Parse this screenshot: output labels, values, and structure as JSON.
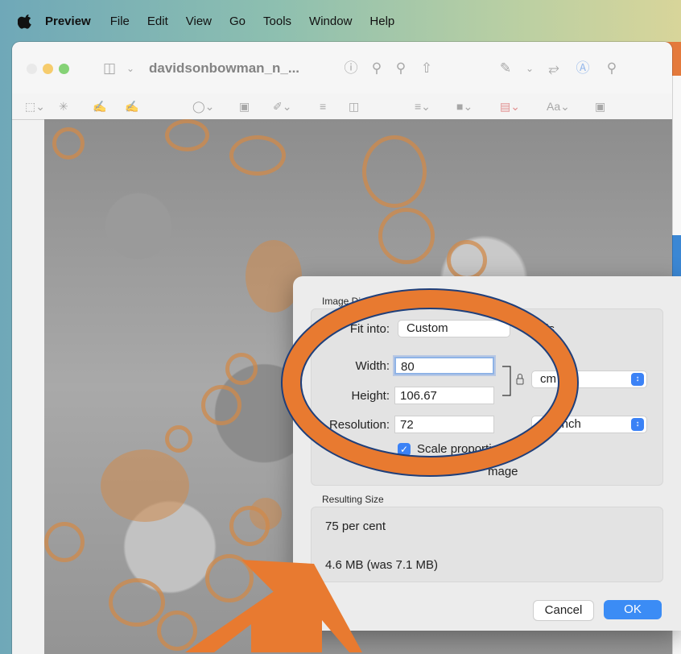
{
  "menubar": {
    "app_name": "Preview",
    "items": [
      "File",
      "Edit",
      "View",
      "Go",
      "Tools",
      "Window",
      "Help"
    ]
  },
  "window": {
    "document_title": "davidsonbowman_n_..."
  },
  "dialog": {
    "image_dimensions_label": "Image Dimensions",
    "fit_into_label": "Fit into:",
    "fit_into_value": "Custom",
    "fit_into_unit_partial": "ixels",
    "width_label": "Width:",
    "width_value": "80",
    "height_label": "Height:",
    "height_value": "106.67",
    "resolution_label": "Resolution:",
    "resolution_value": "72",
    "size_unit_partial": "cm",
    "resolution_unit_partial": "els/inch",
    "scale_label_partial": "Scale proporti",
    "resample_partial": "mage",
    "resulting_size_label": "Resulting Size",
    "percent_text": "75 per cent",
    "size_text": "4.6 MB (was 7.1 MB)",
    "cancel_label": "Cancel",
    "ok_label": "OK"
  },
  "colors": {
    "annotation_orange": "#e87a30",
    "annotation_outline": "#1f3f7a",
    "accent_blue": "#3b8cf5"
  }
}
